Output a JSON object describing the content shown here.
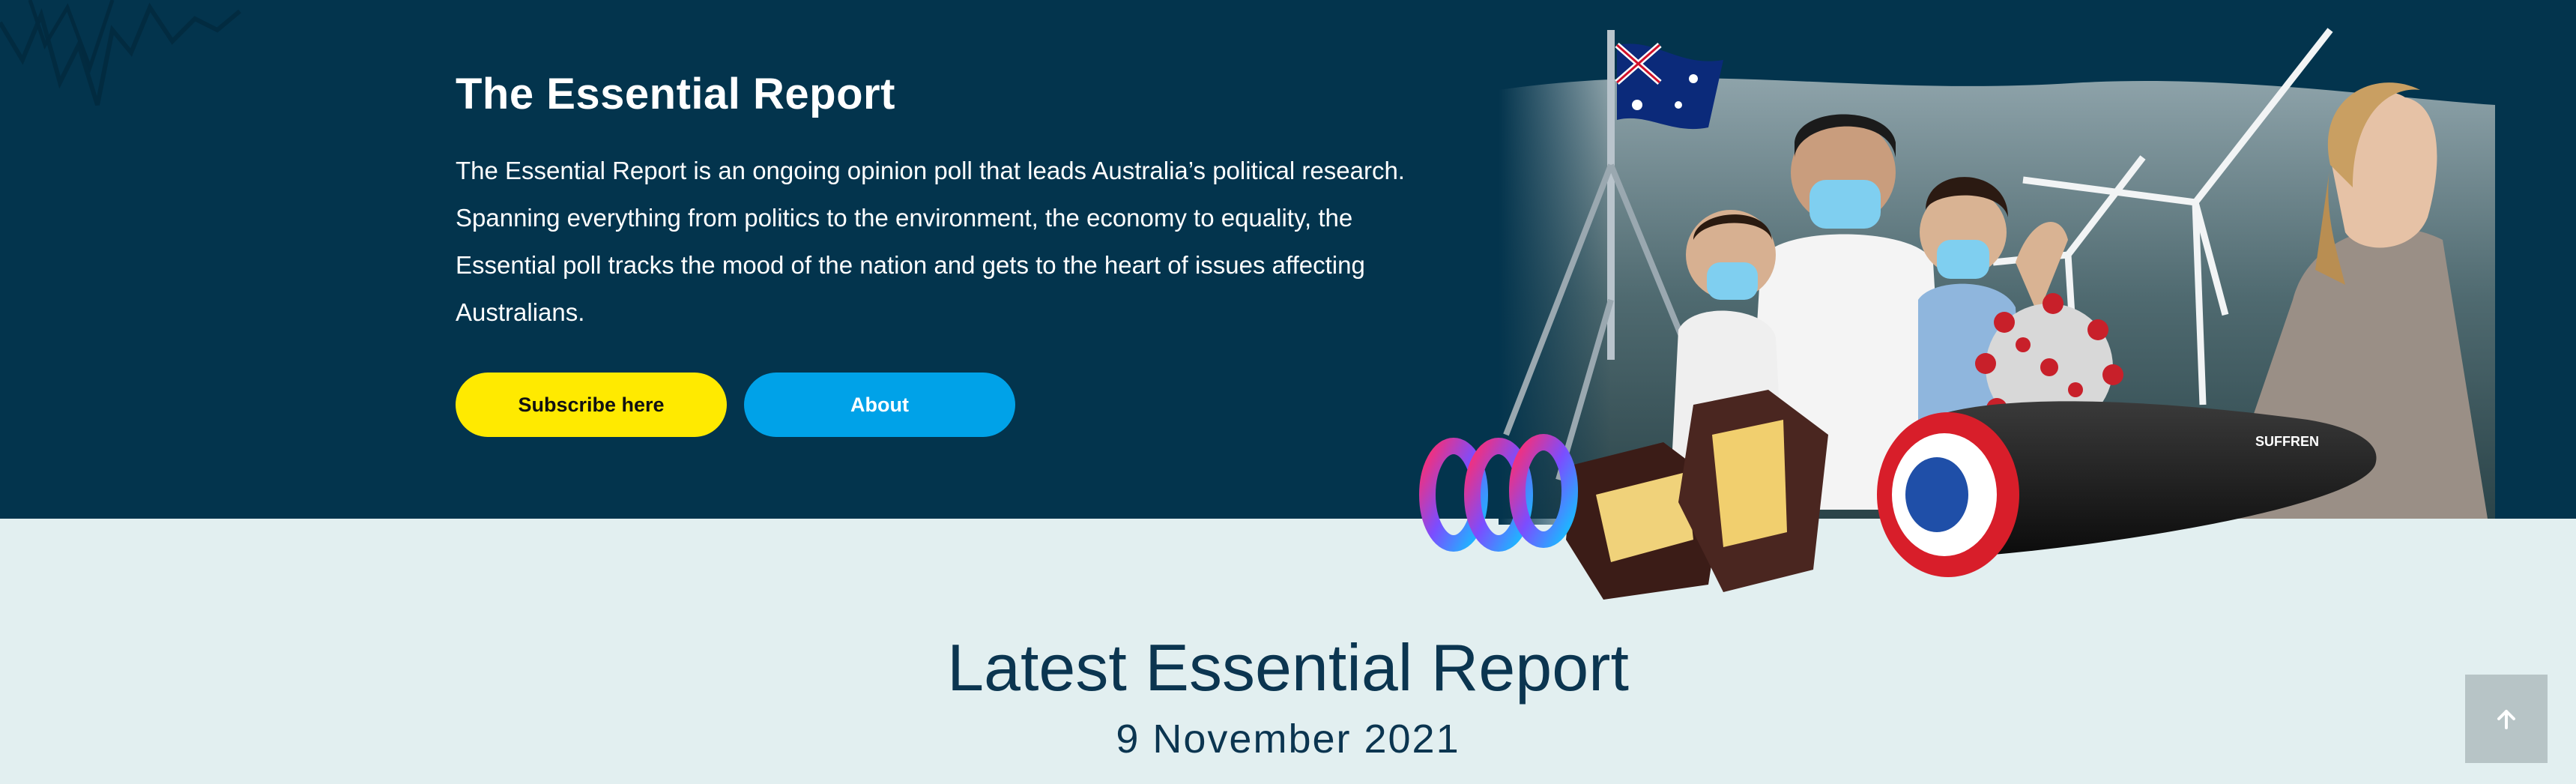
{
  "hero": {
    "title": "The Essential Report",
    "description": "The Essential Report is an ongoing opinion poll that leads Australia’s political research. Spanning everything from politics to the environment, the economy to equality, the Essential poll tracks the mood of the nation and gets to the heart of issues affecting Australians.",
    "subscribe_label": "Subscribe here",
    "about_label": "About",
    "collage_submarine_text": "SUFFREN"
  },
  "latest": {
    "title": "Latest Essential Report",
    "date": "9 November 2021"
  },
  "colors": {
    "hero_bg": "#03344d",
    "page_bg": "#e2eff0",
    "subscribe": "#ffea00",
    "about": "#00a2e8",
    "heading": "#0b3550"
  },
  "icons": {
    "scroll_top": "arrow-up-icon"
  }
}
